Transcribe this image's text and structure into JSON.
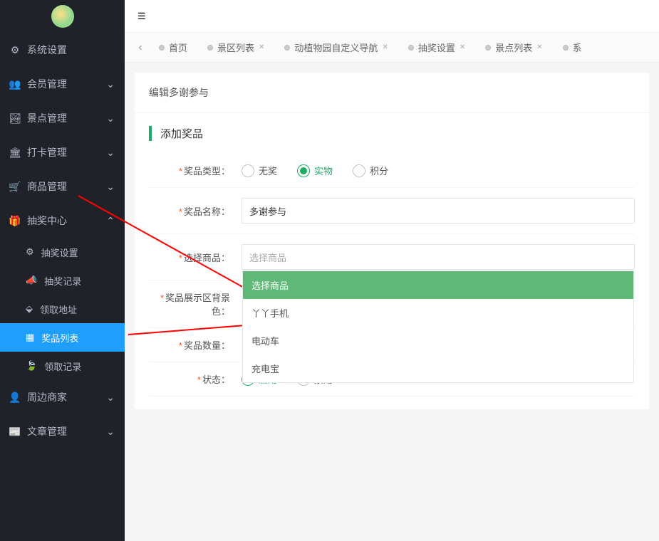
{
  "sidebar": {
    "items": [
      {
        "icon": "⚙",
        "label": "系统设置",
        "expandable": true
      },
      {
        "icon": "👥",
        "label": "会员管理",
        "expandable": true
      },
      {
        "icon": "🏞",
        "label": "景点管理",
        "expandable": true
      },
      {
        "icon": "🏛",
        "label": "打卡管理",
        "expandable": true
      },
      {
        "icon": "🛒",
        "label": "商品管理",
        "expandable": true
      },
      {
        "icon": "🎁",
        "label": "抽奖中心",
        "expandable": true,
        "open": true,
        "children": [
          {
            "icon": "⚙",
            "label": "抽奖设置"
          },
          {
            "icon": "📣",
            "label": "抽奖记录"
          },
          {
            "icon": "📍",
            "label": "领取地址"
          },
          {
            "icon": "📅",
            "label": "奖品列表",
            "active": true
          },
          {
            "icon": "🍃",
            "label": "领取记录"
          }
        ]
      },
      {
        "icon": "👤",
        "label": "周边商家",
        "expandable": true
      },
      {
        "icon": "📰",
        "label": "文章管理",
        "expandable": true
      }
    ]
  },
  "tabs": [
    {
      "label": "首页",
      "closable": false
    },
    {
      "label": "景区列表",
      "closable": true
    },
    {
      "label": "动植物园自定义导航",
      "closable": true
    },
    {
      "label": "抽奖设置",
      "closable": true
    },
    {
      "label": "景点列表",
      "closable": true
    },
    {
      "label": "系",
      "closable": true
    }
  ],
  "page": {
    "title": "编辑多谢参与",
    "section": "添加奖品",
    "fields": {
      "type_label": "奖品类型：",
      "type_options": [
        "无奖",
        "实物",
        "积分"
      ],
      "type_selected": "实物",
      "name_label": "奖品名称：",
      "name_value": "多谢参与",
      "product_label": "选择商品：",
      "product_placeholder": "选择商品",
      "product_options": [
        "选择商品",
        "丫丫手机",
        "电动车",
        "充电宝"
      ],
      "product_selected": "选择商品",
      "bgcolor_label": "奖品展示区背景色：",
      "quantity_label": "奖品数量：",
      "status_label": "状态：",
      "status_options": [
        "启用",
        "禁用"
      ],
      "status_selected": "启用"
    }
  }
}
